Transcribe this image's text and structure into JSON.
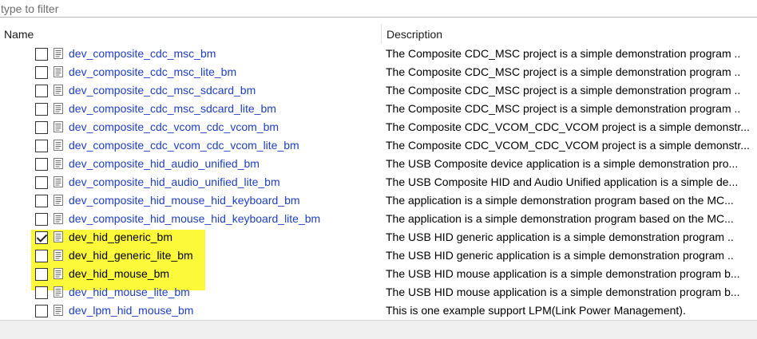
{
  "filter": {
    "placeholder": "type to filter",
    "value": ""
  },
  "columns": {
    "name": "Name",
    "description": "Description"
  },
  "colors": {
    "link": "#1f3fbf",
    "highlight": "#fcf93b"
  },
  "rows": [
    {
      "name": "dev_composite_cdc_msc_bm",
      "description": "The Composite CDC_MSC project is a simple demonstration program ..",
      "checked": false,
      "highlighted": false
    },
    {
      "name": "dev_composite_cdc_msc_lite_bm",
      "description": "The Composite CDC_MSC project is a simple demonstration program ..",
      "checked": false,
      "highlighted": false
    },
    {
      "name": "dev_composite_cdc_msc_sdcard_bm",
      "description": "The Composite CDC_MSC project is a simple demonstration program ..",
      "checked": false,
      "highlighted": false
    },
    {
      "name": "dev_composite_cdc_msc_sdcard_lite_bm",
      "description": "The Composite CDC_MSC project is a simple demonstration program ..",
      "checked": false,
      "highlighted": false
    },
    {
      "name": "dev_composite_cdc_vcom_cdc_vcom_bm",
      "description": "The Composite CDC_VCOM_CDC_VCOM project is a simple demonstr...",
      "checked": false,
      "highlighted": false
    },
    {
      "name": "dev_composite_cdc_vcom_cdc_vcom_lite_bm",
      "description": "The Composite CDC_VCOM_CDC_VCOM project is a simple demonstr...",
      "checked": false,
      "highlighted": false
    },
    {
      "name": "dev_composite_hid_audio_unified_bm",
      "description": "The USB Composite device application is a simple demonstration pro...",
      "checked": false,
      "highlighted": false
    },
    {
      "name": "dev_composite_hid_audio_unified_lite_bm",
      "description": "The USB Composite HID and Audio Unified application is a simple de...",
      "checked": false,
      "highlighted": false
    },
    {
      "name": "dev_composite_hid_mouse_hid_keyboard_bm",
      "description": "The application is a simple demonstration program based on the MC...",
      "checked": false,
      "highlighted": false
    },
    {
      "name": "dev_composite_hid_mouse_hid_keyboard_lite_bm",
      "description": "The application is a simple demonstration program based on the MC...",
      "checked": false,
      "highlighted": false
    },
    {
      "name": "dev_hid_generic_bm",
      "description": "The USB HID generic application is a simple demonstration program ..",
      "checked": true,
      "highlighted": true
    },
    {
      "name": "dev_hid_generic_lite_bm",
      "description": "The USB HID generic application is a simple demonstration program ..",
      "checked": false,
      "highlighted": true
    },
    {
      "name": "dev_hid_mouse_bm",
      "description": "The USB HID mouse application is a simple demonstration program b...",
      "checked": false,
      "highlighted": true
    },
    {
      "name": "dev_hid_mouse_lite_bm",
      "description": "The USB HID mouse application is a simple demonstration program b...",
      "checked": false,
      "highlighted": false
    },
    {
      "name": "dev_lpm_hid_mouse_bm",
      "description": "This is one example support LPM(Link Power Management).",
      "checked": false,
      "highlighted": false
    }
  ]
}
